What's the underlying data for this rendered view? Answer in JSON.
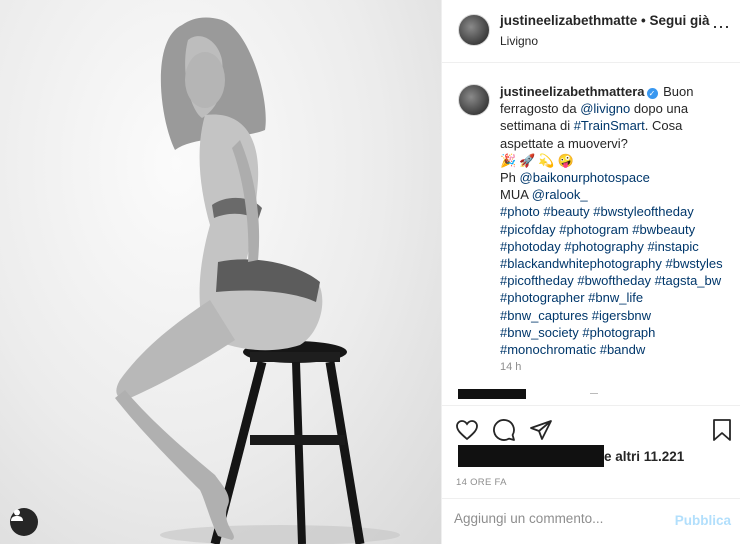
{
  "post": {
    "username": "justineelizabethmatte",
    "follow_text": "• Segui già",
    "location": "Livigno",
    "more_icon": "⋯"
  },
  "caption": {
    "username": "justineelizabethmattera",
    "verified_icon": "✓",
    "text_1": "Buon ferragosto da ",
    "mention_livigno": "@livigno",
    "text_2": " dopo una settimana di ",
    "hashtag_trainsmart": "#TrainSmart",
    "text_3": ". Cosa aspettate a muovervi?",
    "emojis": "🎉🚀💫🤪",
    "ph_label": "Ph ",
    "ph_mention": "@baikonurphotospace",
    "mua_label": "MUA ",
    "mua_mention": "@ralook_",
    "hashtags": "#photo #beauty #bwstyleoftheday #picofday #photogram #bwbeauty #photoday #photography #instapic #blackandwhitephotography #bwstyles #picoftheday #bwoftheday #tagsta_bw #photographer #bnw_life #bnw_captures #igersbnw #bnw_society #photograph #monochromatic #bandw",
    "time": "14 h"
  },
  "actions": {
    "like_icon": "heart-icon",
    "comment_icon": "comment-icon",
    "share_icon": "share-icon",
    "save_icon": "bookmark-icon"
  },
  "likes": {
    "text": "e altri 11.221"
  },
  "time_ago": "14 ORE FA",
  "comment": {
    "placeholder": "Aggiungi un commento...",
    "publish_label": "Pubblica"
  },
  "colors": {
    "link": "#00376b",
    "verified": "#3897f0",
    "publish_disabled": "#b2dffc",
    "muted": "#8e8e8e"
  }
}
